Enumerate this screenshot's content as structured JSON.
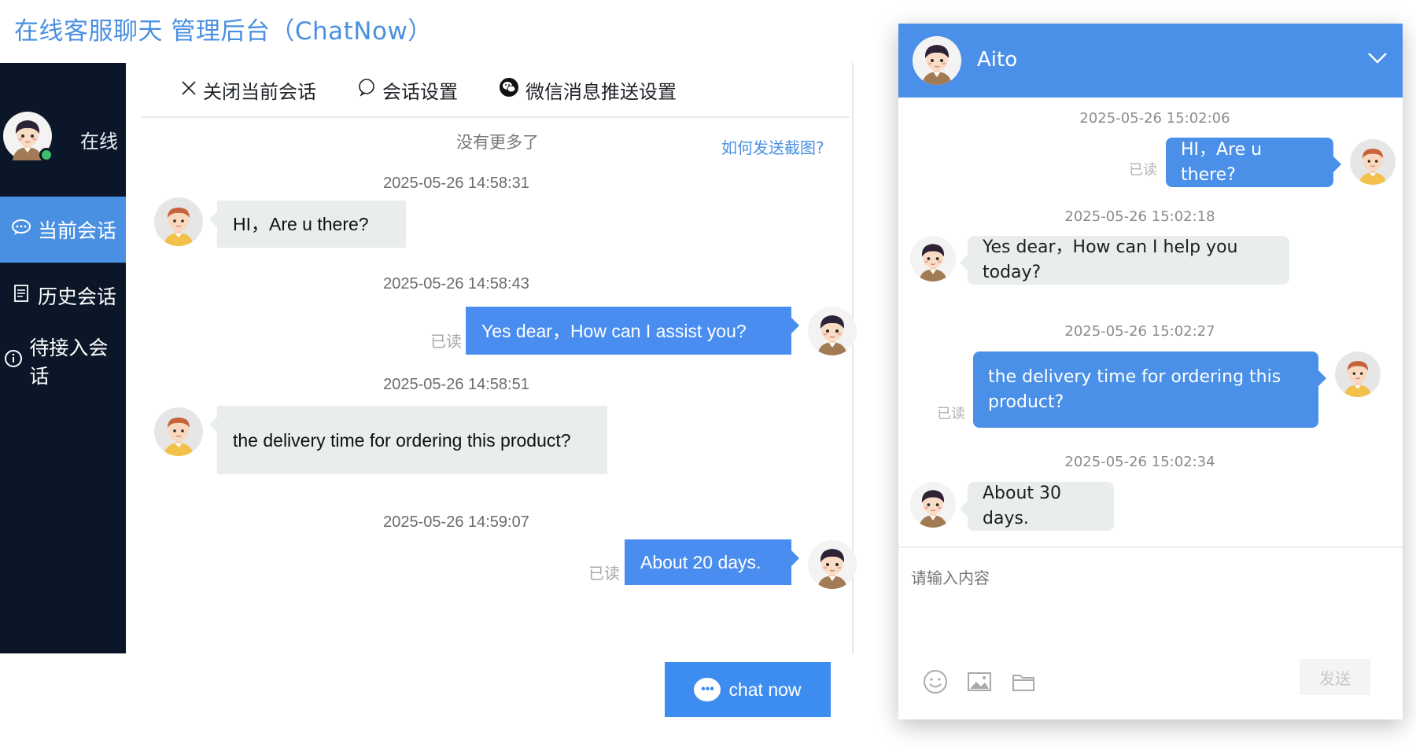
{
  "app": {
    "title": "在线客服聊天 管理后台（ChatNow）"
  },
  "sidebar": {
    "status": "在线",
    "items": [
      {
        "label": "当前会话",
        "icon": "chat-bubble-icon",
        "active": true
      },
      {
        "label": "历史会话",
        "icon": "document-icon",
        "active": false
      },
      {
        "label": "待接入会话",
        "icon": "info-icon",
        "active": false
      }
    ]
  },
  "toolbar": {
    "close_label": "关闭当前会话",
    "settings_label": "会话设置",
    "wechat_label": "微信消息推送设置"
  },
  "main": {
    "no_more": "没有更多了",
    "how_screenshot": "如何发送截图?",
    "messages": [
      {
        "time": "2025-05-26 14:58:31",
        "text": "HI，Are u there?",
        "from": "customer"
      },
      {
        "time": "2025-05-26 14:58:43",
        "text": "Yes dear，How can I assist you?",
        "from": "agent",
        "status": "已读"
      },
      {
        "time": "2025-05-26 14:58:51",
        "text": "the delivery time for ordering this product?",
        "from": "customer"
      },
      {
        "time": "2025-05-26 14:59:07",
        "text": "About 20 days.",
        "from": "agent",
        "status": "已读"
      }
    ]
  },
  "chat_now": {
    "label": "chat now"
  },
  "widget": {
    "agent_name": "Aito",
    "messages": [
      {
        "time": "2025-05-26 15:02:06",
        "text": "HI，Are u there?",
        "from": "customer",
        "status": "已读"
      },
      {
        "time": "2025-05-26 15:02:18",
        "text": "Yes dear，How can I help you today?",
        "from": "agent"
      },
      {
        "time": "2025-05-26 15:02:27",
        "text": "the delivery time for ordering this product?",
        "from": "customer",
        "status": "已读"
      },
      {
        "time": "2025-05-26 15:02:34",
        "text": "About 30 days.",
        "from": "agent"
      }
    ],
    "input_placeholder": "请输入内容",
    "send_label": "发送"
  },
  "colors": {
    "accent": "#4a90e2",
    "sidebar_bg": "#0b1728",
    "online": "#3cbf6b"
  }
}
